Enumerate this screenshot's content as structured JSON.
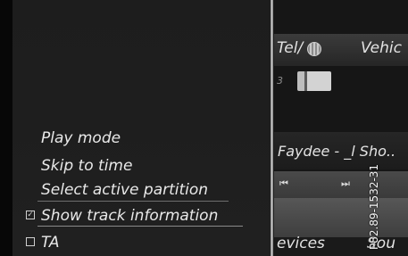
{
  "menu": {
    "items": [
      {
        "label": "Play mode",
        "checkbox": false
      },
      {
        "label": "Skip to time",
        "checkbox": false
      },
      {
        "label": "Select active partition",
        "checkbox": false
      },
      {
        "label": "Show track information",
        "checkbox": true,
        "checked": true
      },
      {
        "label": "TA",
        "checkbox": true,
        "checked": false
      }
    ],
    "selected_index": 3
  },
  "background": {
    "tabs": {
      "left": "Tel/",
      "right": "Vehic"
    },
    "small_number": "3",
    "track_title": "Faydee - _l Sho..",
    "bottom_tabs": {
      "left": "evices",
      "right": "Sou"
    }
  },
  "controls": {
    "prev": "⏮",
    "next": "⏭"
  },
  "watermark": "P82.89-1532-31",
  "icons": [
    "globe-icon",
    "usb-icon",
    "checkbox-icon",
    "previous-track-icon",
    "next-track-icon"
  ]
}
